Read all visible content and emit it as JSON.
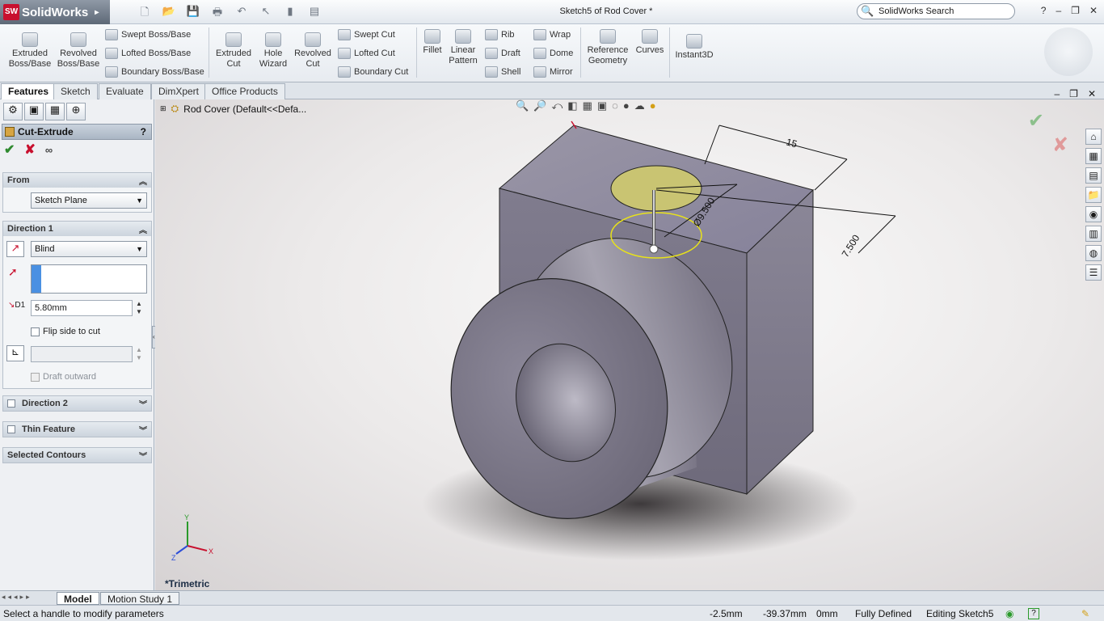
{
  "app": {
    "name": "SolidWorks",
    "window_title": "Sketch5 of Rod Cover *",
    "search_placeholder": "SolidWorks Search"
  },
  "ribbon": {
    "extruded_boss": "Extruded Boss/Base",
    "revolved_boss": "Revolved Boss/Base",
    "swept_boss": "Swept Boss/Base",
    "lofted_boss": "Lofted Boss/Base",
    "boundary_boss": "Boundary Boss/Base",
    "extruded_cut": "Extruded Cut",
    "hole_wizard": "Hole Wizard",
    "revolved_cut": "Revolved Cut",
    "swept_cut": "Swept Cut",
    "lofted_cut": "Lofted Cut",
    "boundary_cut": "Boundary Cut",
    "fillet": "Fillet",
    "linear_pattern": "Linear Pattern",
    "rib": "Rib",
    "draft": "Draft",
    "shell": "Shell",
    "wrap": "Wrap",
    "dome": "Dome",
    "mirror": "Mirror",
    "reference_geometry": "Reference Geometry",
    "curves": "Curves",
    "instant3d": "Instant3D"
  },
  "tabs": [
    "Features",
    "Sketch",
    "Evaluate",
    "DimXpert",
    "Office Products"
  ],
  "feature": {
    "title": "Cut-Extrude",
    "help": "?",
    "from_label": "From",
    "from_value": "Sketch Plane",
    "direction1_label": "Direction 1",
    "end_condition": "Blind",
    "depth_value": "5.80mm",
    "depth_icon_label": "D1",
    "flip_side_label": "Flip side to cut",
    "draft_outward_label": "Draft outward",
    "direction2_label": "Direction 2",
    "thin_feature_label": "Thin Feature",
    "selected_contours_label": "Selected Contours"
  },
  "viewport": {
    "tree_item": "Rod Cover  (Default<<Defa...",
    "view_name": "*Trimetric",
    "dim_15": "15",
    "dim_9500": "Ø9.500",
    "dim_7500": "7.500",
    "axis_x": "X",
    "axis_y": "Y",
    "axis_z": "Z"
  },
  "bottom_tabs": [
    "Model",
    "Motion Study 1"
  ],
  "status": {
    "message": "Select a handle to modify parameters",
    "x": "-2.5mm",
    "y": "-39.37mm",
    "z": "0mm",
    "state": "Fully Defined",
    "editing": "Editing Sketch5"
  },
  "colors": {
    "accent": "#c8102e",
    "model_face": "#8e8a98",
    "sketch_yellow": "#e8e21a"
  }
}
